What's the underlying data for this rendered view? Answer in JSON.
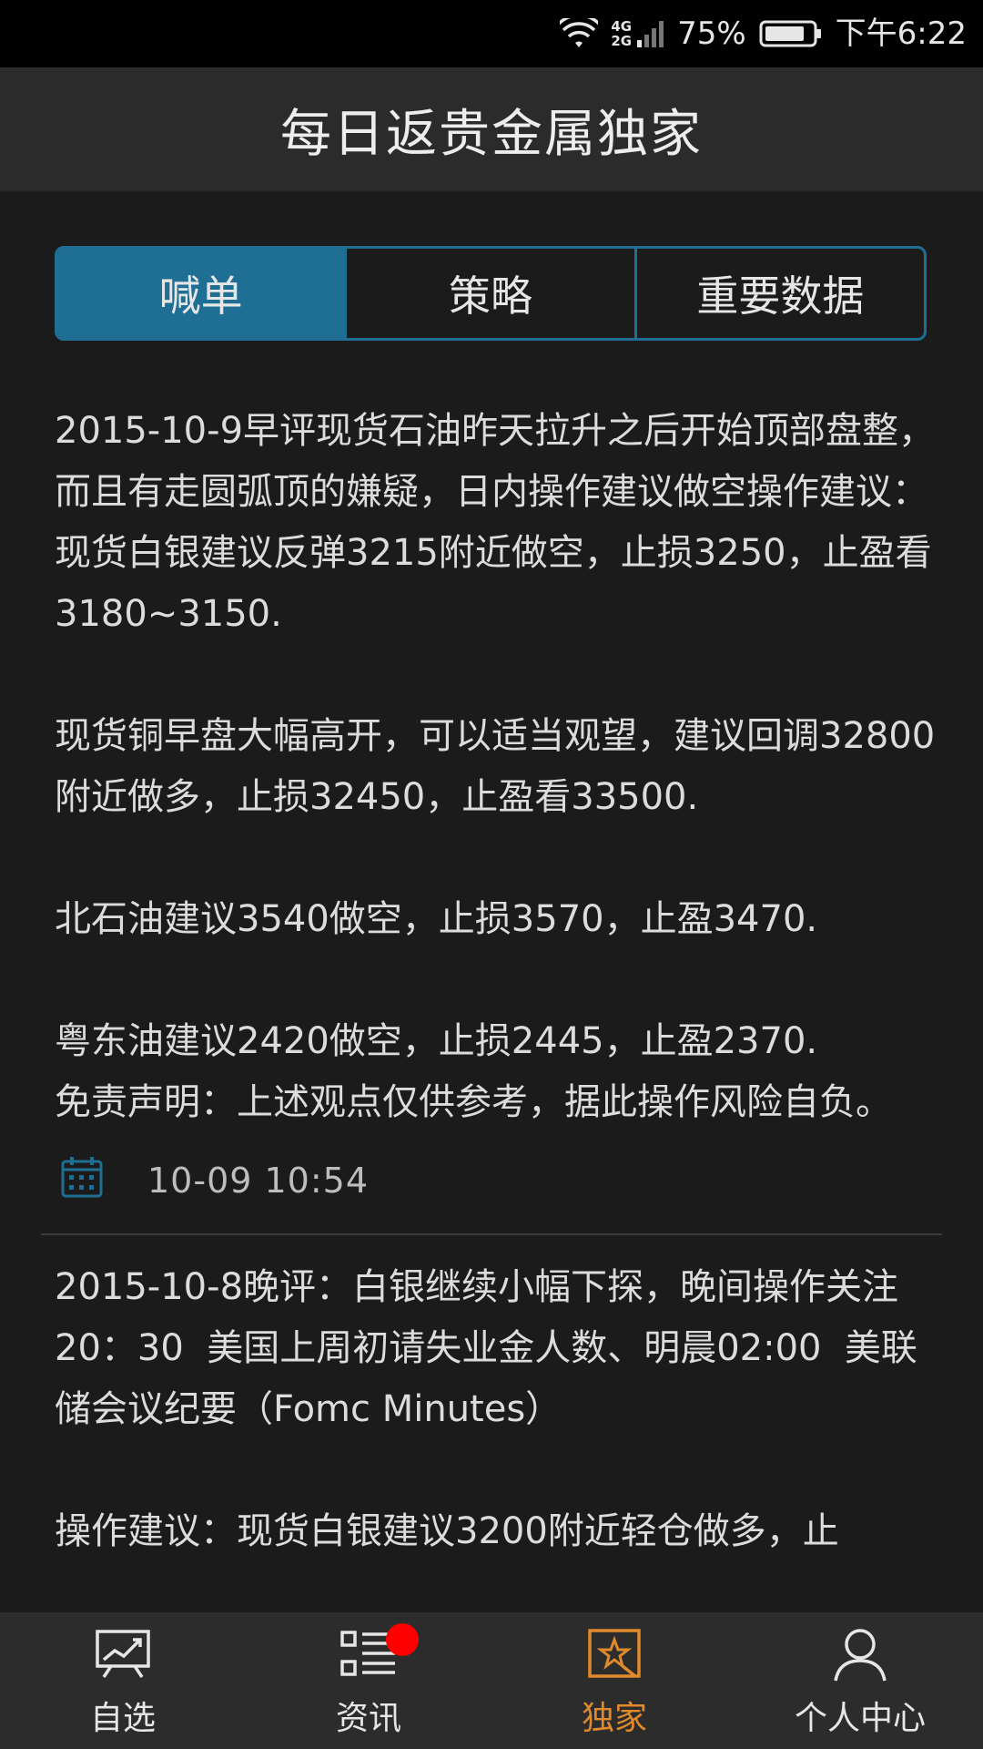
{
  "status_bar": {
    "network_top": "4G",
    "network_bottom": "2G",
    "battery": "75%",
    "time": "下午6:22"
  },
  "header": {
    "title": "每日返贵金属独家"
  },
  "tabs": [
    {
      "label": "喊单",
      "active": true
    },
    {
      "label": "策略",
      "active": false
    },
    {
      "label": "重要数据",
      "active": false
    }
  ],
  "posts": [
    {
      "paragraphs": [
        "2015-10-9早评现货石油昨天拉升之后开始顶部盘整，而且有走圆弧顶的嫌疑，日内操作建议做空操作建议：现货白银建议反弹3215附近做空，止损3250，止盈看3180~3150.",
        "现货铜早盘大幅高开，可以适当观望，建议回调32800附近做多，止损32450，止盈看33500.",
        "北石油建议3540做空，止损3570，止盈3470.",
        "粤东油建议2420做空，止损2445，止盈2370.\n免责声明：上述观点仅供参考，据此操作风险自负。"
      ],
      "datetime": "10-09  10:54"
    },
    {
      "paragraphs": [
        "2015-10-8晚评：白银继续小幅下探，晚间操作关注20：30  美国上周初请失业金人数、明晨02:00  美联储会议纪要（Fomc Minutes）",
        "操作建议：现货白银建议3200附近轻仓做多，止"
      ]
    }
  ],
  "bottom_nav": [
    {
      "label": "自选",
      "icon": "chart-icon",
      "active": false
    },
    {
      "label": "资讯",
      "icon": "news-list-icon",
      "active": false,
      "badge": true
    },
    {
      "label": "独家",
      "icon": "star-frame-icon",
      "active": true
    },
    {
      "label": "个人中心",
      "icon": "person-icon",
      "active": false
    }
  ],
  "colors": {
    "accent_blue": "#1f6f95",
    "active_orange": "#e08a2c",
    "badge_red": "#ff0000",
    "background": "#1b1b1b"
  }
}
